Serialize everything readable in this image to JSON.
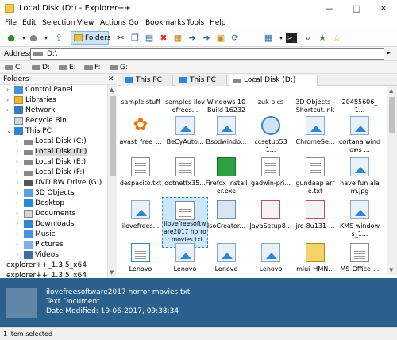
{
  "window": {
    "title": "Local Disk (D:) - Explorer++",
    "minimize": "—",
    "maximize": "□",
    "close": "✕"
  },
  "menu": [
    "File",
    "Edit",
    "Selection",
    "View",
    "Actions",
    "Go",
    "Bookmarks",
    "Tools",
    "Help"
  ],
  "toolbar": {
    "folders_label": "Folders"
  },
  "address": {
    "label": "Address",
    "value": "D:\\",
    "go": "▸"
  },
  "drives": [
    "C:",
    "D:",
    "E:",
    "F:",
    "G:"
  ],
  "tree": {
    "title": "Folders",
    "close": "✕",
    "items": [
      "Control Panel",
      "Libraries",
      "Network",
      "Recycle Bin",
      "This PC",
      "Local Disk (C:)",
      "Local Disk (D:)",
      "Local Disk (E:)",
      "Local Disk (F:)",
      "DVD RW Drive (G:)",
      "3D Objects",
      "Desktop",
      "Documents",
      "Downloads",
      "Music",
      "Pictures",
      "Videos",
      "explorer++_1.3.5_x64",
      "explorer++_1.3.5_x64"
    ]
  },
  "tabs": [
    "This PC",
    "This PC",
    "Local Disk (D:)"
  ],
  "files": [
    "sample stuff",
    "samples ilovefrees...",
    "Windows 10 Build 16232",
    "zuk pics",
    "3D Objects - Shortcut.lnk",
    "20455606_1...",
    "avast_free_...",
    "BeCyAuto...",
    "Bsodwindo...",
    "ccsetup531...",
    "ChromeSe...",
    "cortana windows ...",
    "despacito.txt",
    "dotnetfx35...",
    "Firefox Installer.exe",
    "gadwin-pri...",
    "gundaap arre.txt",
    "have fun alam.jpg",
    "ilovefrees...",
    "ilovefreesoftware2017 horror movies.txt",
    "IsoCreator...",
    "JavaSetup8...",
    "jre-8u131-...",
    "KMS windows_1...",
    "Lenovo",
    "Lenovo",
    "Lenovo",
    "Lenovo",
    "miui_HMN...",
    "MS-Office-..."
  ],
  "preview": {
    "name": "ilovefreesoftware2017 horror movies.txt",
    "type": "Text Document",
    "modified": "Date Modified: 19-06-2017, 09:38:34"
  },
  "status": {
    "text": "1 item selected"
  },
  "colors": {
    "accent": "#2b5f8c",
    "selection": "#cce8ff",
    "folder": "#e7b93d"
  }
}
